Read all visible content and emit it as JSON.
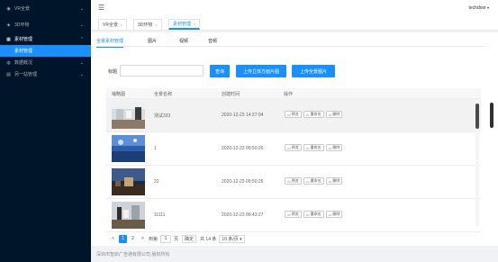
{
  "sidebar": {
    "items": [
      {
        "icon": "vr-icon",
        "glyph": "◉",
        "label": "VR全景",
        "arrow": "⌄"
      },
      {
        "icon": "3d-icon",
        "glyph": "◈",
        "label": "3D环物",
        "arrow": "⌄"
      },
      {
        "icon": "material-icon",
        "glyph": "▦",
        "label": "素材管理",
        "arrow": "⌃"
      },
      {
        "icon": "stats-icon",
        "glyph": "◍",
        "label": "数据概况",
        "arrow": "⌄"
      },
      {
        "icon": "assistant-icon",
        "glyph": "▤",
        "label": "另一站管理",
        "arrow": "⌄"
      }
    ],
    "active_sub": "素材管理"
  },
  "header": {
    "menu_glyph": "☰",
    "user": "techdoor",
    "caret": "▾"
  },
  "tabs": [
    {
      "label": "VR全景",
      "close": "×"
    },
    {
      "label": "3D环物",
      "close": "×"
    },
    {
      "label": "素材管理",
      "close": "×"
    }
  ],
  "subtabs": [
    "全景素材管理",
    "图片",
    "视频",
    "音频"
  ],
  "filter": {
    "label": "标题",
    "value": "",
    "placeholder": ""
  },
  "buttons": {
    "search": "查询",
    "upload_cube": "上传立体方面片图",
    "upload_full": "上传全景图片"
  },
  "table": {
    "headers": [
      "缩略图",
      "全景名称",
      "创建时间",
      "操作"
    ],
    "rows": [
      {
        "name": "测试333",
        "time": "2020-12-23 14:27:04"
      },
      {
        "name": "1",
        "time": "2020-12-23 09:50:26"
      },
      {
        "name": "22",
        "time": "2020-12-23 09:50:26"
      },
      {
        "name": "11111",
        "time": "2020-12-23 09:43:27"
      }
    ],
    "ops": [
      {
        "glyph": "▭",
        "label": "预览"
      },
      {
        "glyph": "▭",
        "label": "重命名"
      },
      {
        "glyph": "▭",
        "label": "删除"
      }
    ]
  },
  "pager": {
    "prev": "<",
    "pages": [
      "1",
      "2"
    ],
    "next": ">",
    "goto_label": "到第",
    "goto_value": "1",
    "page_unit": "页",
    "confirm": "确定",
    "total": "共 14 条",
    "size": "10 条/页 ▾"
  },
  "footer": "深圳市智启广告通有限公司 版权所有"
}
